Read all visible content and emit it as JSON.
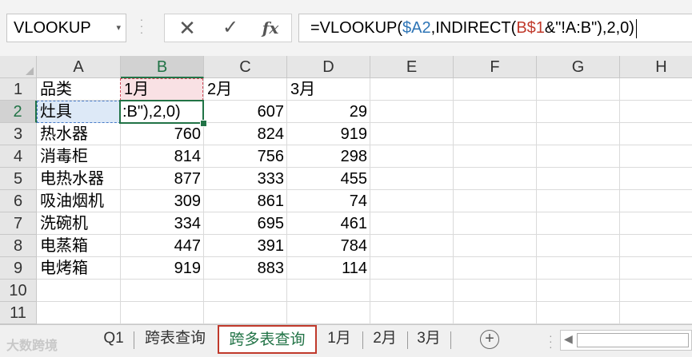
{
  "namebox": {
    "value": "VLOOKUP",
    "arrow": "▾"
  },
  "formula_bar": {
    "cancel_icon": "✕",
    "enter_icon": "✓",
    "fx_label": "fx",
    "formula_parts": [
      "=VLOOKUP(",
      "$A2",
      ",INDIRECT(",
      "B$1",
      "&\"!A:B\"),2,0)"
    ]
  },
  "columns": [
    "A",
    "B",
    "C",
    "D",
    "E",
    "F",
    "G",
    "H"
  ],
  "rows": [
    "1",
    "2",
    "3",
    "4",
    "5",
    "6",
    "7",
    "8",
    "9",
    "10",
    "11"
  ],
  "cells": {
    "header": [
      "品类",
      "1月",
      "2月",
      "3月"
    ],
    "data": [
      {
        "cat": "灶具",
        "b": ":B\"),2,0)",
        "c": "607",
        "d": "29"
      },
      {
        "cat": "热水器",
        "b": "760",
        "c": "824",
        "d": "919"
      },
      {
        "cat": "消毒柜",
        "b": "814",
        "c": "756",
        "d": "298"
      },
      {
        "cat": "电热水器",
        "b": "877",
        "c": "333",
        "d": "455"
      },
      {
        "cat": "吸油烟机",
        "b": "309",
        "c": "861",
        "d": "74"
      },
      {
        "cat": "洗碗机",
        "b": "334",
        "c": "695",
        "d": "461"
      },
      {
        "cat": "电蒸箱",
        "b": "447",
        "c": "391",
        "d": "784"
      },
      {
        "cat": "电烤箱",
        "b": "919",
        "c": "883",
        "d": "114"
      }
    ]
  },
  "sheet_tabs": {
    "watermark": "大数跨境",
    "tabs": [
      "Q1",
      "跨表查询",
      "跨多表查询",
      "1月",
      "2月",
      "3月"
    ],
    "active": "跨多表查询",
    "add_icon": "+"
  },
  "colors": {
    "excel_green": "#217346",
    "active_tab_border": "#c0392b",
    "ref_blue": "#2e75b6",
    "ref_red": "#c0392b"
  }
}
